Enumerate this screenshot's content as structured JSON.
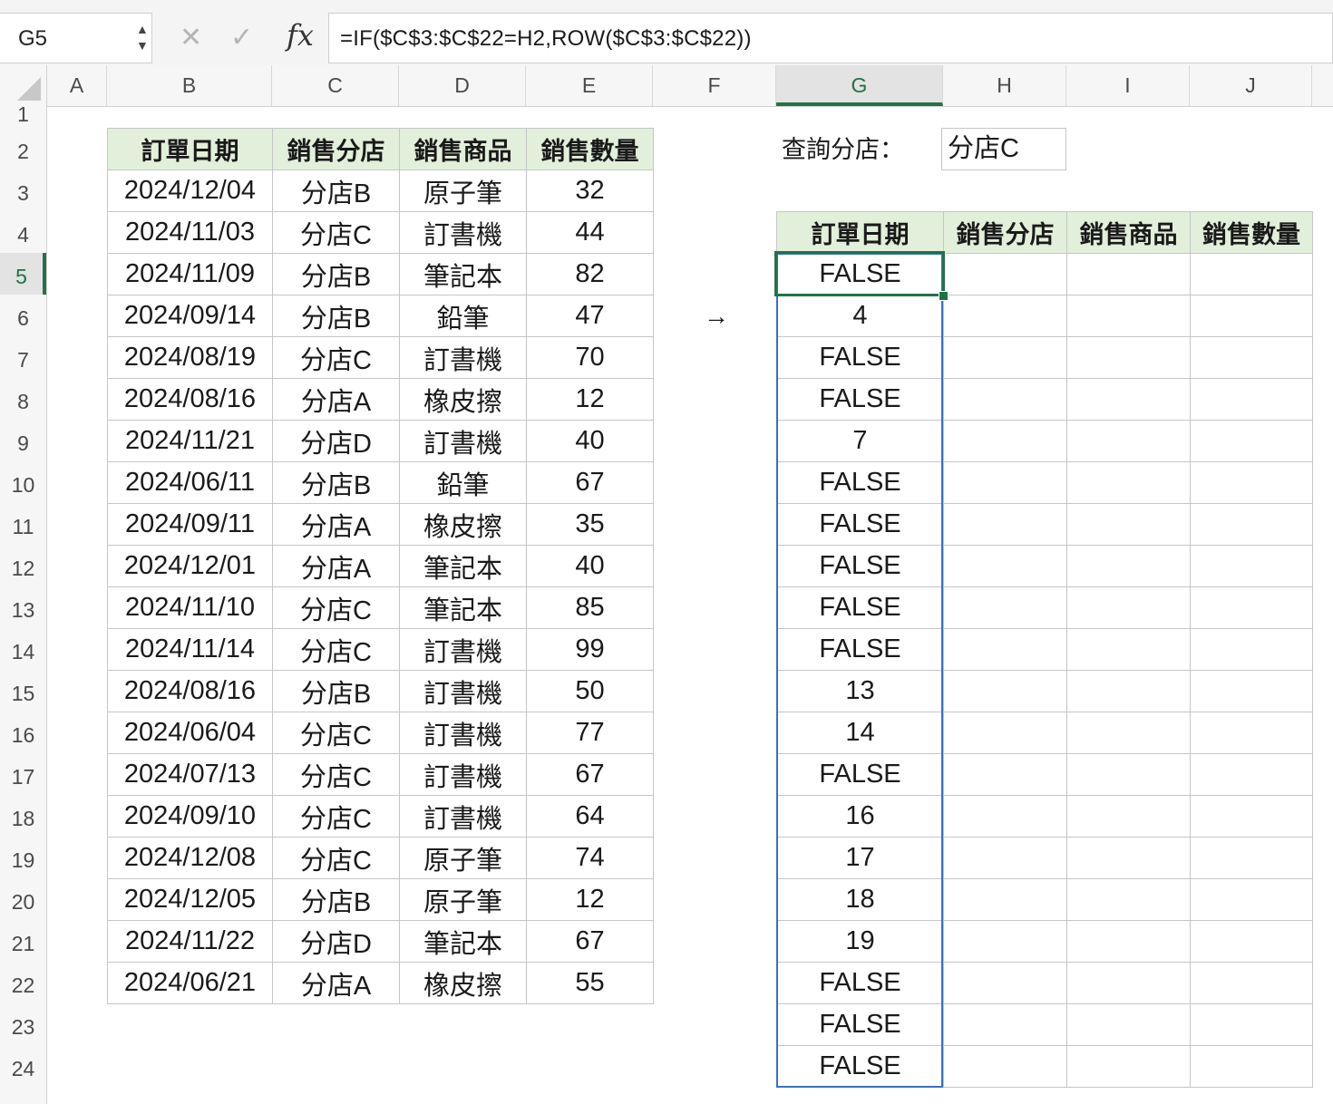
{
  "name_box": {
    "value": "G5"
  },
  "formula_bar": {
    "formula": "=IF($C$3:$C$22=H2,ROW($C$3:$C$22))"
  },
  "icons": [
    "spin-arrows-icon",
    "cancel-x-icon",
    "confirm-check-icon",
    "fx-icon",
    "select-all-corner-icon",
    "right-arrow-icon"
  ],
  "columns": [
    "A",
    "B",
    "C",
    "D",
    "E",
    "F",
    "G",
    "H",
    "I",
    "J"
  ],
  "selected_column": "G",
  "rows": [
    "1",
    "2",
    "3",
    "4",
    "5",
    "6",
    "7",
    "8",
    "9",
    "10",
    "11",
    "12",
    "13",
    "14",
    "15",
    "16",
    "17",
    "18",
    "19",
    "20",
    "21",
    "22",
    "23",
    "24"
  ],
  "selected_row": "5",
  "source_table": {
    "headers": [
      "訂單日期",
      "銷售分店",
      "銷售商品",
      "銷售數量"
    ],
    "rows": [
      [
        "2024/12/04",
        "分店B",
        "原子筆",
        "32"
      ],
      [
        "2024/11/03",
        "分店C",
        "訂書機",
        "44"
      ],
      [
        "2024/11/09",
        "分店B",
        "筆記本",
        "82"
      ],
      [
        "2024/09/14",
        "分店B",
        "鉛筆",
        "47"
      ],
      [
        "2024/08/19",
        "分店C",
        "訂書機",
        "70"
      ],
      [
        "2024/08/16",
        "分店A",
        "橡皮擦",
        "12"
      ],
      [
        "2024/11/21",
        "分店D",
        "訂書機",
        "40"
      ],
      [
        "2024/06/11",
        "分店B",
        "鉛筆",
        "67"
      ],
      [
        "2024/09/11",
        "分店A",
        "橡皮擦",
        "35"
      ],
      [
        "2024/12/01",
        "分店A",
        "筆記本",
        "40"
      ],
      [
        "2024/11/10",
        "分店C",
        "筆記本",
        "85"
      ],
      [
        "2024/11/14",
        "分店C",
        "訂書機",
        "99"
      ],
      [
        "2024/08/16",
        "分店B",
        "訂書機",
        "50"
      ],
      [
        "2024/06/04",
        "分店C",
        "訂書機",
        "77"
      ],
      [
        "2024/07/13",
        "分店C",
        "訂書機",
        "67"
      ],
      [
        "2024/09/10",
        "分店C",
        "訂書機",
        "64"
      ],
      [
        "2024/12/08",
        "分店C",
        "原子筆",
        "74"
      ],
      [
        "2024/12/05",
        "分店B",
        "原子筆",
        "12"
      ],
      [
        "2024/11/22",
        "分店D",
        "筆記本",
        "67"
      ],
      [
        "2024/06/21",
        "分店A",
        "橡皮擦",
        "55"
      ]
    ]
  },
  "lookup": {
    "label": "查詢分店：",
    "value": "分店C"
  },
  "arrow": "→",
  "result_table": {
    "headers": [
      "訂單日期",
      "銷售分店",
      "銷售商品",
      "銷售數量"
    ],
    "g_values": [
      "FALSE",
      "4",
      "FALSE",
      "FALSE",
      "7",
      "FALSE",
      "FALSE",
      "FALSE",
      "FALSE",
      "FALSE",
      "13",
      "14",
      "FALSE",
      "16",
      "17",
      "18",
      "19",
      "FALSE",
      "FALSE",
      "FALSE"
    ]
  },
  "colors": {
    "header_fill": "#e2efda",
    "excel_green": "#217346",
    "spill_border": "#3670c8"
  }
}
